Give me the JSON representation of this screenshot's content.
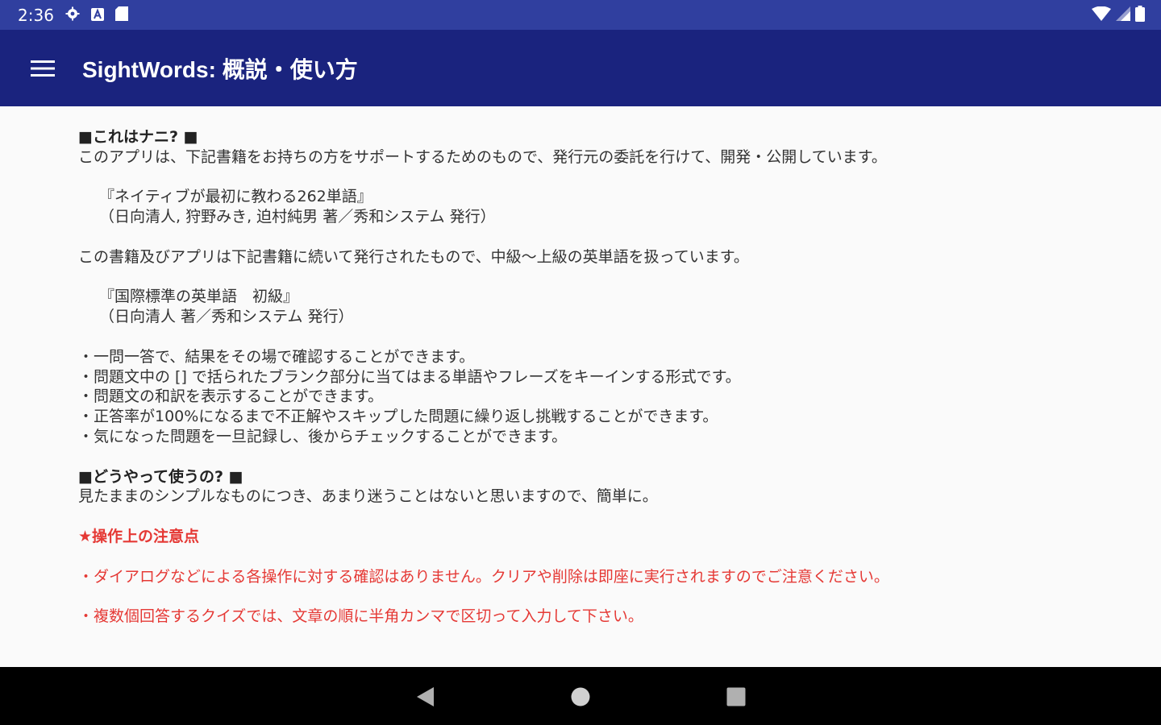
{
  "status_bar": {
    "time": "2:36",
    "left_icons": [
      "gear-icon",
      "a-badge-icon",
      "sd-card-icon"
    ],
    "right_icons": [
      "wifi-icon",
      "cell-signal-icon",
      "battery-icon"
    ]
  },
  "app_bar": {
    "title": "SightWords: 概説・使い方",
    "menu_icon": "hamburger-menu-icon"
  },
  "content": {
    "section1_heading": "■これはナニ? ■",
    "section1_intro": "このアプリは、下記書籍をお持ちの方をサポートするためのもので、発行元の委託を行けて、開発・公開しています。",
    "book1_title": "『ネイティブが最初に教わる262単語』",
    "book1_authors": "（日向清人, 狩野みき, 迫村純男 著／秀和システム 発行）",
    "relation_text": "この書籍及びアプリは下記書籍に続いて発行されたもので、中級〜上級の英単語を扱っています。",
    "book2_title": "『国際標準の英単語　初級』",
    "book2_authors": "（日向清人 著／秀和システム 発行）",
    "features": [
      "・一問一答で、結果をその場で確認することができます。",
      "・問題文中の [] で括られたブランク部分に当てはまる単語やフレーズをキーインする形式です。",
      "・問題文の和訳を表示することができます。",
      "・正答率が100%になるまで不正解やスキップした問題に繰り返し挑戦することができます。",
      "・気になった問題を一旦記録し、後からチェックすることができます。"
    ],
    "section2_heading": "■どうやって使うの? ■",
    "section2_intro": "見たままのシンプルなものにつき、あまり迷うことはないと思いますので、簡単に。",
    "notice_heading": "★操作上の注意点",
    "notice_items": [
      "・ダイアログなどによる各操作に対する確認はありません。クリアや削除は即座に実行されますのでご注意ください。",
      "・複数個回答するクイズでは、文章の順に半角カンマで区切って入力して下さい。"
    ]
  },
  "nav_bar": {
    "back_icon": "back-triangle-icon",
    "home_icon": "home-circle-icon",
    "recents_icon": "recents-square-icon"
  },
  "colors": {
    "status_bar": "#303f9f",
    "app_bar": "#1a237e",
    "content_bg": "#fafafa",
    "notice_red": "#e53935",
    "nav_bar": "#000000"
  }
}
